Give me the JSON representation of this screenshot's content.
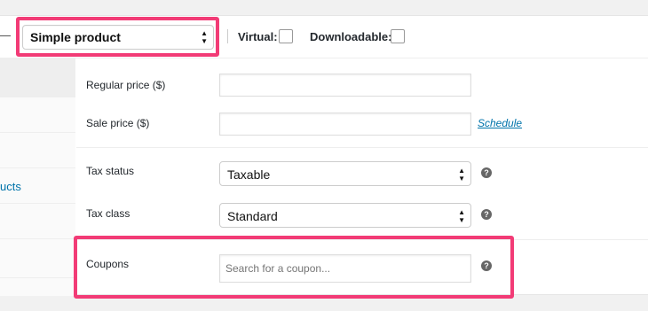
{
  "header": {
    "product_type": "Simple product",
    "virtual_label": "Virtual:",
    "downloadable_label": "Downloadable:"
  },
  "sidebar": {
    "items": [
      {
        "label": ""
      },
      {
        "label": ""
      },
      {
        "label": ""
      },
      {
        "label": "ucts"
      },
      {
        "label": ""
      },
      {
        "label": ""
      }
    ]
  },
  "pricing": {
    "regular_price_label": "Regular price ($)",
    "regular_price_value": "",
    "sale_price_label": "Sale price ($)",
    "sale_price_value": "",
    "schedule_link": "Schedule"
  },
  "tax": {
    "status_label": "Tax status",
    "status_value": "Taxable",
    "class_label": "Tax class",
    "class_value": "Standard"
  },
  "coupons": {
    "label": "Coupons",
    "placeholder": "Search for a coupon..."
  },
  "help_icon_glyph": "?",
  "colors": {
    "highlight": "#f23b76",
    "link": "#0073aa"
  }
}
